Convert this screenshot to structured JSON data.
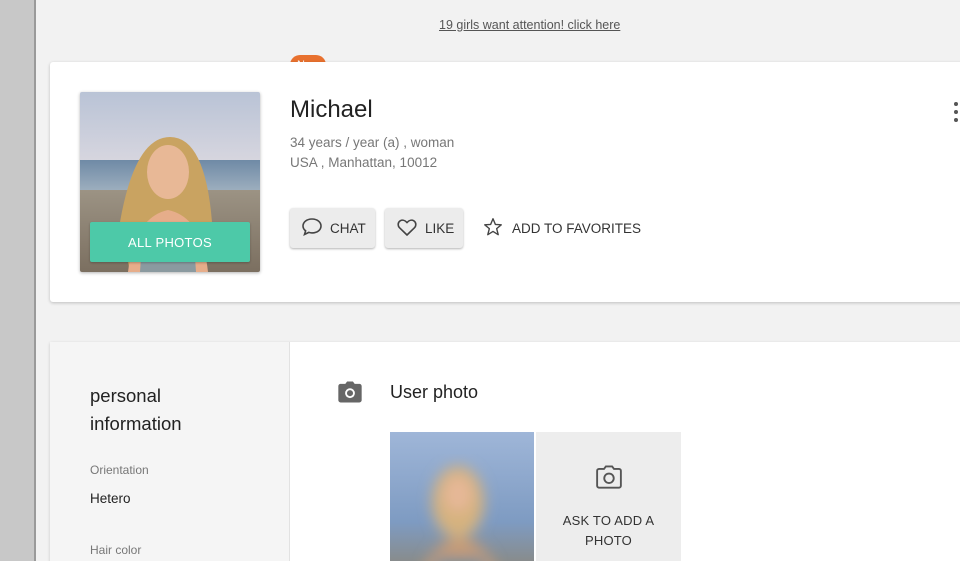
{
  "promo": {
    "link_text": "19 girls want attention! click here"
  },
  "profile": {
    "badge": "New",
    "name": "Michael",
    "age_gender": "34 years / year (a) ,  woman",
    "location": "USA , Manhattan, 10012",
    "all_photos_label": "ALL PHOTOS"
  },
  "actions": {
    "chat_label": "CHAT",
    "like_label": "LIKE",
    "favorites_label": "ADD TO FAVORITES"
  },
  "personal_info": {
    "title": "personal information",
    "fields": [
      {
        "label": "Orientation",
        "value": "Hetero"
      },
      {
        "label": "Hair color",
        "value": ""
      }
    ]
  },
  "photos_section": {
    "title": "User photo",
    "ask_label": "ASK TO ADD A PHOTO"
  },
  "colors": {
    "accent_green": "#4dc9a8",
    "badge_orange": "#e8712f",
    "page_bg": "#f2f2f2"
  },
  "icons": [
    "chat-bubble-icon",
    "heart-icon",
    "star-icon",
    "more-vertical-icon",
    "camera-icon"
  ]
}
